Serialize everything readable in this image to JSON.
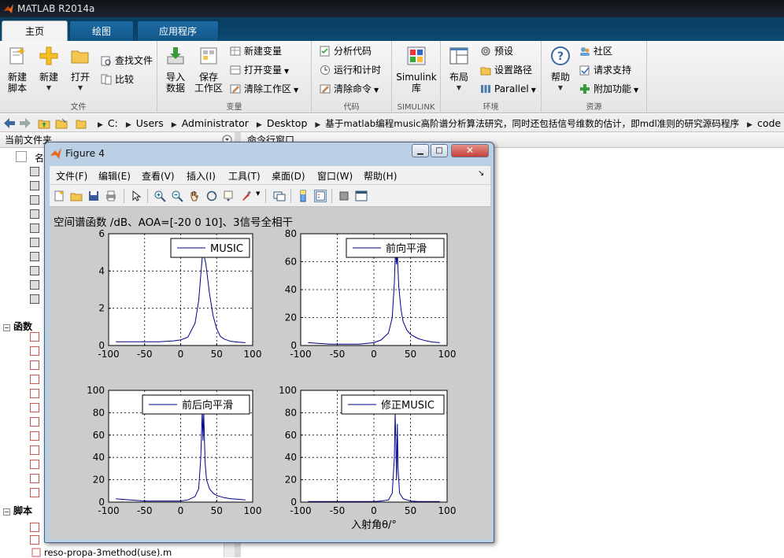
{
  "app": {
    "title": "MATLAB R2014a"
  },
  "ribbon": {
    "tabs": [
      "主页",
      "绘图",
      "应用程序"
    ],
    "sections": {
      "file": "文件",
      "variable": "变量",
      "code": "代码",
      "simulink": "SIMULINK",
      "environment": "环境",
      "resources": "资源"
    },
    "new_script": [
      "新建",
      "脚本"
    ],
    "new": "新建",
    "open": "打开",
    "find_files": "查找文件",
    "compare": "比较",
    "import_data": [
      "导入",
      "数据"
    ],
    "save_workspace": [
      "保存",
      "工作区"
    ],
    "new_variable": "新建变量",
    "open_variable": "打开变量",
    "clear_workspace": "清除工作区",
    "analyze_code": "分析代码",
    "run_and_time": "运行和计时",
    "clear_commands": "清除命令",
    "simulink": [
      "Simulink",
      "库"
    ],
    "layout": "布局",
    "preferences": "预设",
    "set_path": "设置路径",
    "parallel": "Parallel",
    "help": "帮助",
    "community": "社区",
    "request_support": "请求支持",
    "add_ons": "附加功能"
  },
  "address": {
    "crumbs": [
      "C:",
      "Users",
      "Administrator",
      "Desktop",
      "基于matlab编程music高阶谱分析算法研究，同时还包括信号维数的估计，即mdl准则的研究源码程序",
      "code"
    ]
  },
  "panels": {
    "current_folder": "当前文件夹",
    "command_window": "命令行窗口",
    "name_col": "名",
    "functions": "函数",
    "scripts": "脚本",
    "file_item": "reso-propa-3method(use).m"
  },
  "figure": {
    "title": "Figure 4",
    "menus": [
      "文件(F)",
      "编辑(E)",
      "查看(V)",
      "插入(I)",
      "工具(T)",
      "桌面(D)",
      "窗口(W)",
      "帮助(H)"
    ]
  },
  "chart_data": [
    {
      "type": "line",
      "title": "空间谱函数 /dB、AOA=[-20  0  10]、3信号全相干",
      "legend": "MUSIC",
      "xlim": [
        -100,
        100
      ],
      "ylim": [
        0,
        6
      ],
      "xticks": [
        -100,
        -50,
        0,
        50,
        100
      ],
      "yticks": [
        0,
        2,
        4,
        6
      ],
      "grid": true,
      "color": "#00008b",
      "x": [
        -90,
        -60,
        -30,
        -10,
        0,
        10,
        20,
        25,
        28,
        30,
        32,
        35,
        40,
        45,
        50,
        55,
        60,
        70,
        80,
        90
      ],
      "y": [
        0.2,
        0.2,
        0.2,
        0.25,
        0.3,
        0.45,
        1.2,
        2.4,
        3.8,
        4.7,
        4.9,
        4.4,
        2.8,
        1.6,
        0.9,
        0.5,
        0.35,
        0.22,
        0.18,
        0.15
      ]
    },
    {
      "type": "line",
      "legend": "前向平滑",
      "xlim": [
        -100,
        100
      ],
      "ylim": [
        0,
        80
      ],
      "xticks": [
        -100,
        -50,
        0,
        50,
        100
      ],
      "yticks": [
        0,
        20,
        40,
        60,
        80
      ],
      "grid": true,
      "color": "#00008b",
      "x": [
        -90,
        -60,
        -40,
        -20,
        0,
        10,
        20,
        25,
        28,
        29,
        30,
        31,
        32,
        34,
        37,
        40,
        45,
        50,
        60,
        70,
        80,
        90
      ],
      "y": [
        2,
        1,
        1,
        1,
        2,
        4,
        9,
        20,
        45,
        62,
        65,
        58,
        66,
        42,
        26,
        17,
        11,
        8,
        5,
        3.5,
        2.5,
        2
      ]
    },
    {
      "type": "line",
      "legend": "前后向平滑",
      "xlim": [
        -100,
        100
      ],
      "ylim": [
        0,
        100
      ],
      "xticks": [
        -100,
        -50,
        0,
        50,
        100
      ],
      "yticks": [
        0,
        20,
        40,
        60,
        80,
        100
      ],
      "grid": true,
      "color": "#00008b",
      "x": [
        -90,
        -70,
        -50,
        -30,
        -10,
        0,
        10,
        20,
        25,
        28,
        30,
        31,
        32,
        34,
        36,
        40,
        45,
        50,
        60,
        70,
        80,
        90
      ],
      "y": [
        3,
        2,
        1,
        1,
        1,
        1,
        2,
        5,
        12,
        40,
        82,
        55,
        80,
        35,
        20,
        12,
        8,
        6,
        4,
        3,
        2.5,
        2
      ]
    },
    {
      "type": "line",
      "legend": "修正MUSIC",
      "xlabel": "入射角θ/°",
      "xlim": [
        -100,
        100
      ],
      "ylim": [
        0,
        100
      ],
      "xticks": [
        -100,
        -50,
        0,
        50,
        100
      ],
      "yticks": [
        0,
        20,
        40,
        60,
        80,
        100
      ],
      "grid": true,
      "color": "#00008b",
      "x": [
        -90,
        -60,
        -30,
        0,
        10,
        20,
        25,
        28,
        29,
        30,
        31,
        32,
        33,
        35,
        40,
        50,
        60,
        90
      ],
      "y": [
        0.5,
        0.5,
        0.5,
        0.5,
        1,
        2,
        8,
        40,
        80,
        55,
        20,
        70,
        30,
        8,
        3,
        1,
        0.5,
        0.5
      ]
    }
  ]
}
